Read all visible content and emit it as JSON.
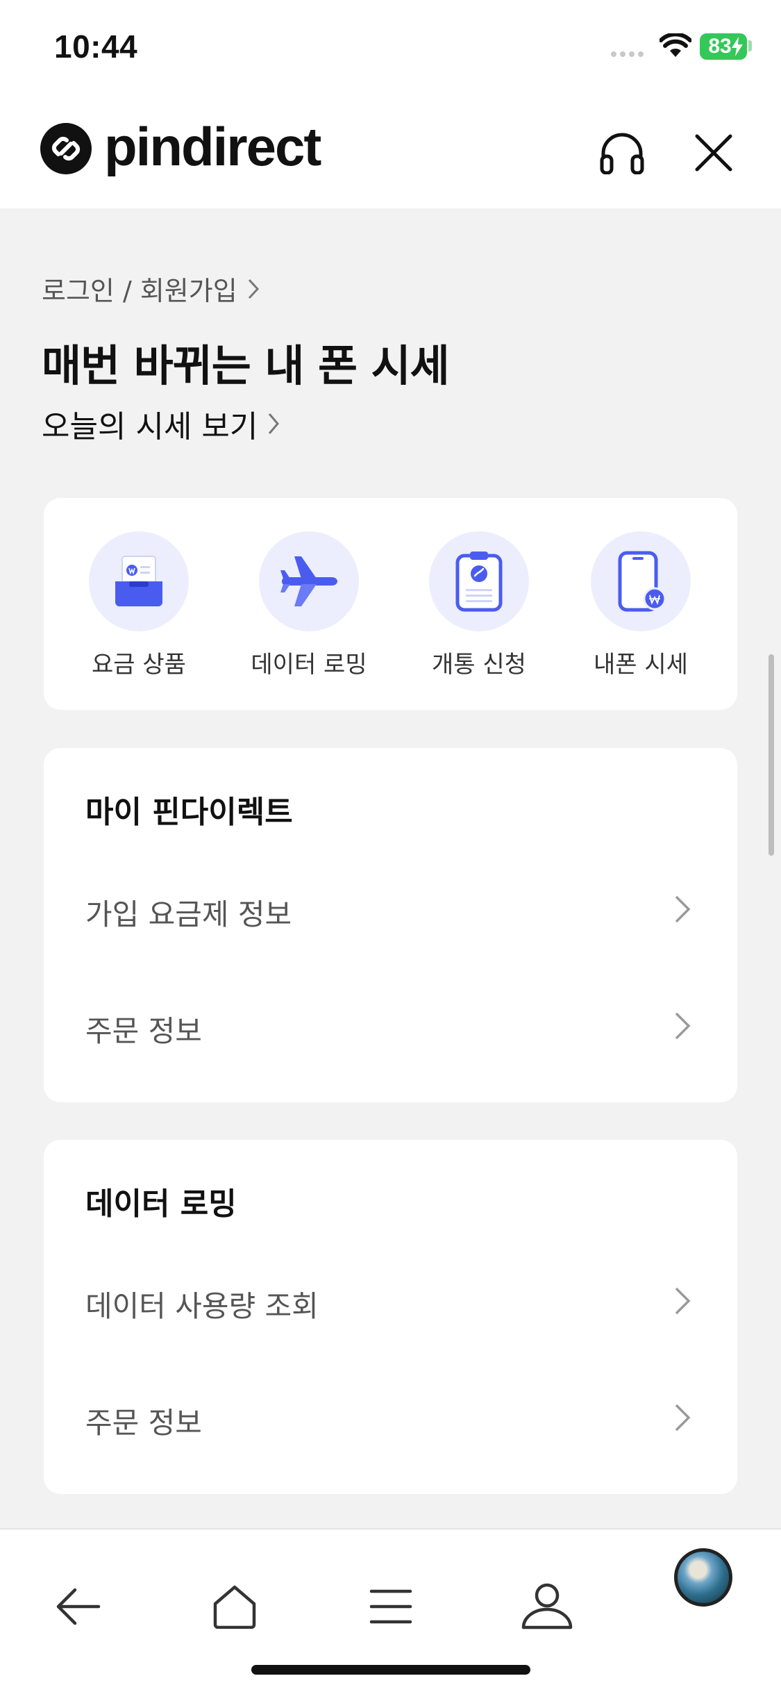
{
  "status_bar": {
    "time": "10:44",
    "battery": "83"
  },
  "header": {
    "logo_text": "pindirect"
  },
  "hero": {
    "login_link": "로그인 / 회원가입",
    "title": "매번 바뀌는 내 폰 시세",
    "subtitle": "오늘의 시세 보기"
  },
  "quick_menu": {
    "items": [
      {
        "label": "요금 상품",
        "icon": "plan-box-icon"
      },
      {
        "label": "데이터 로밍",
        "icon": "airplane-icon"
      },
      {
        "label": "개통 신청",
        "icon": "clipboard-icon"
      },
      {
        "label": "내폰 시세",
        "icon": "phone-price-icon"
      }
    ]
  },
  "my_section": {
    "title": "마이 핀다이렉트",
    "rows": [
      {
        "label": "가입 요금제 정보"
      },
      {
        "label": "주문 정보"
      }
    ]
  },
  "roaming_section": {
    "title": "데이터 로밍",
    "rows": [
      {
        "label": "데이터 사용량 조회"
      },
      {
        "label": "주문 정보"
      }
    ]
  },
  "colors": {
    "accent": "#4a5cf0",
    "accent_light": "#eceefd",
    "battery": "#34c759"
  }
}
